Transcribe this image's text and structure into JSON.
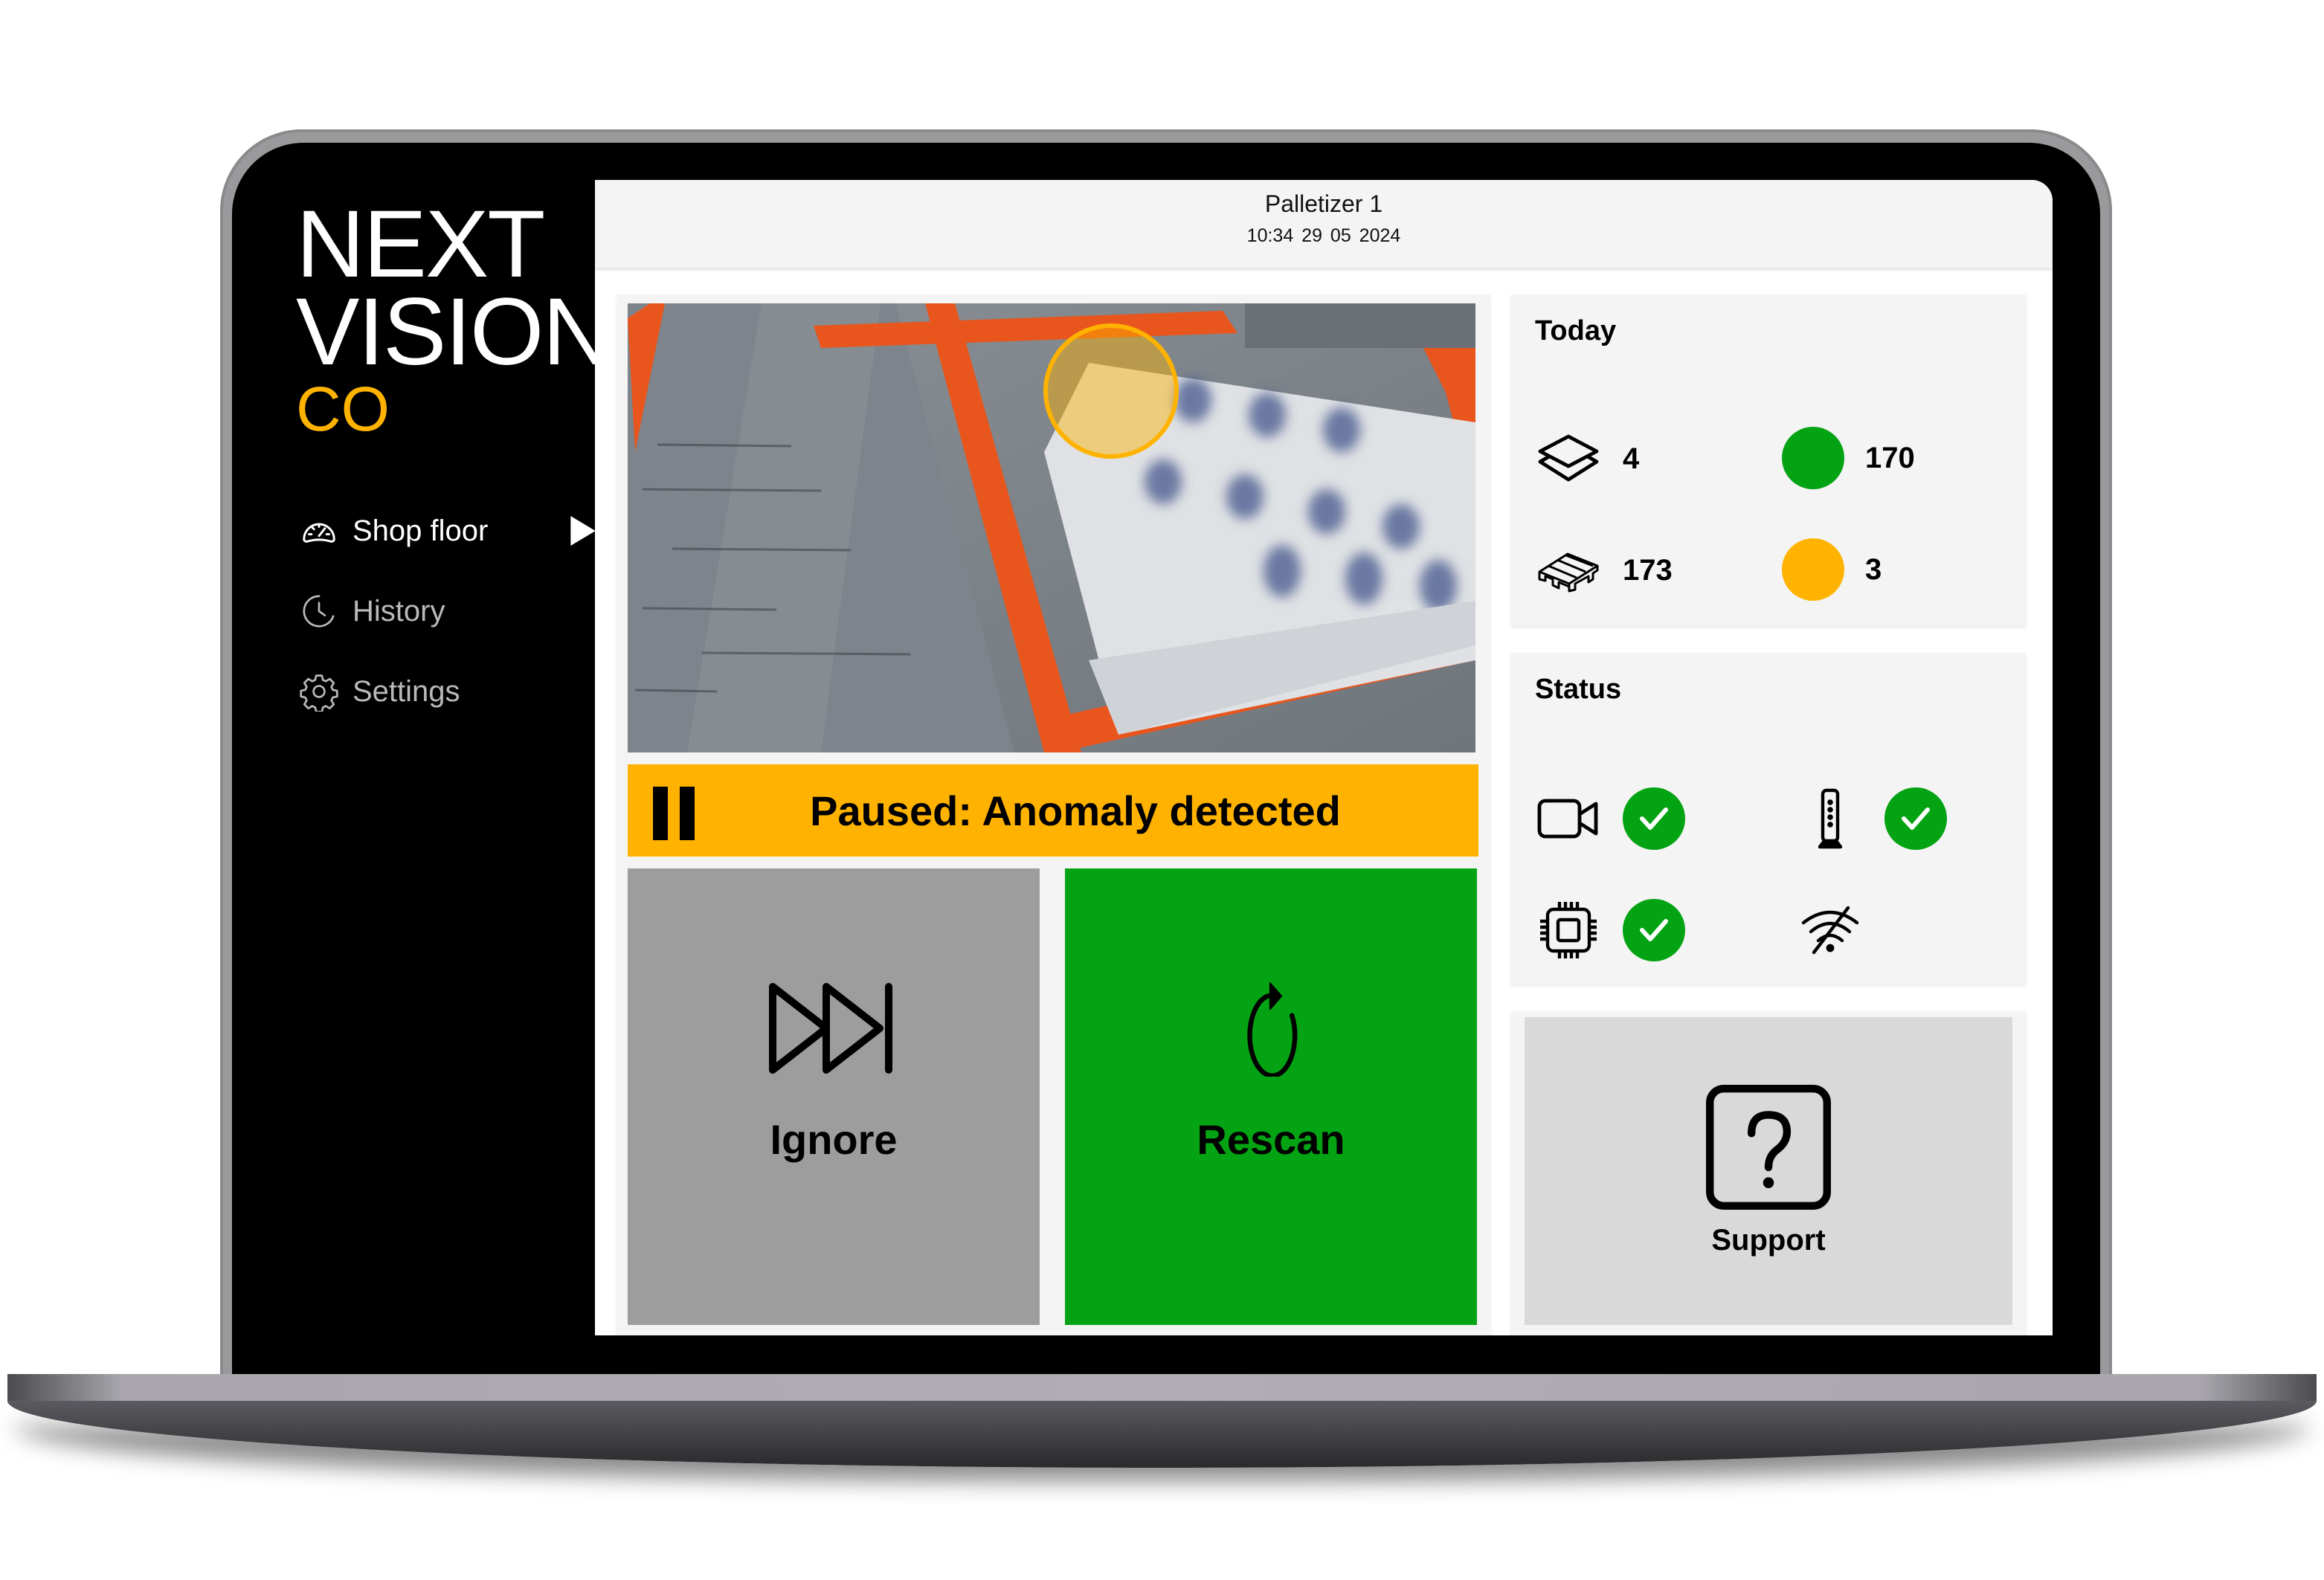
{
  "brand": {
    "line1": "NEXT",
    "line2": "VISION",
    "line3": "CO",
    "accent_color": "#ffb300"
  },
  "sidebar": {
    "items": [
      {
        "label": "Shop floor",
        "icon": "gauge-icon",
        "active": true
      },
      {
        "label": "History",
        "icon": "clock-icon",
        "active": false
      },
      {
        "label": "Settings",
        "icon": "gear-icon",
        "active": false
      }
    ]
  },
  "header": {
    "title": "Palletizer 1",
    "time": "10:34",
    "date": "29 05 2024",
    "datetime": "10:34  29 05 2024"
  },
  "camera": {
    "description": "Live camera feed of pallet on conveyor with anomaly highlighted",
    "anomaly_marker_color": "#ffb300"
  },
  "alert": {
    "icon": "pause-icon",
    "message": "Paused: Anomaly detected",
    "color": "#ffb300"
  },
  "actions": {
    "ignore": {
      "label": "Ignore",
      "icon": "skip-forward-icon",
      "color": "#9d9d9d"
    },
    "rescan": {
      "label": "Rescan",
      "icon": "rotate-cw-icon",
      "color": "#03a313"
    }
  },
  "today": {
    "title": "Today",
    "layers": {
      "icon": "layers-icon",
      "value": "4"
    },
    "pallets": {
      "icon": "pallet-icon",
      "value": "173"
    },
    "ok": {
      "icon": "green-dot",
      "value": "170",
      "color": "#03a313"
    },
    "anomalies": {
      "icon": "orange-dot",
      "value": "3",
      "color": "#ffb300"
    }
  },
  "status": {
    "title": "Status",
    "items": [
      {
        "name": "camera",
        "icon": "video-camera-icon",
        "ok": true
      },
      {
        "name": "sensor",
        "icon": "sensor-tower-icon",
        "ok": true
      },
      {
        "name": "processor",
        "icon": "cpu-chip-icon",
        "ok": true
      },
      {
        "name": "wifi",
        "icon": "wifi-off-icon",
        "ok": false
      }
    ]
  },
  "support": {
    "label": "Support",
    "icon": "help-box-icon"
  }
}
